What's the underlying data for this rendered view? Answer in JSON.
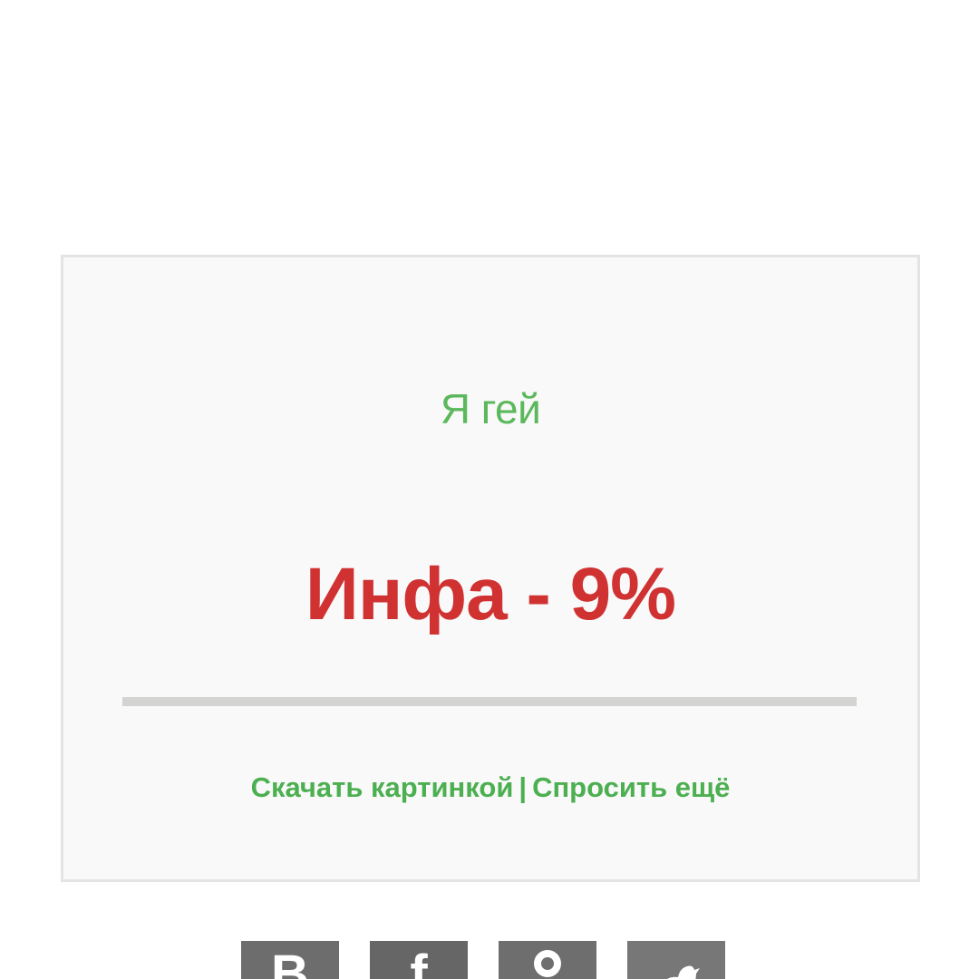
{
  "card": {
    "question": "Я гей",
    "answer": "Инфа - 9%",
    "probability_percent": 9,
    "links": {
      "download_label": "Скачать картинкой",
      "separator": "|",
      "ask_again_label": "Спросить ещё"
    }
  },
  "share": {
    "buttons": [
      {
        "icon": "vk-icon",
        "glyph": "В"
      },
      {
        "icon": "facebook-icon",
        "glyph": "f"
      },
      {
        "icon": "odnoklassniki-icon",
        "glyph": ""
      },
      {
        "icon": "twitter-icon",
        "glyph": ""
      }
    ]
  },
  "colors": {
    "question": "#5cb85c",
    "answer": "#d03232",
    "links": "#4caf50",
    "card_background": "#f9f9f9",
    "card_border": "#e4e4e4",
    "divider": "#d3d3d1",
    "share_button": "#6d6d6d"
  }
}
